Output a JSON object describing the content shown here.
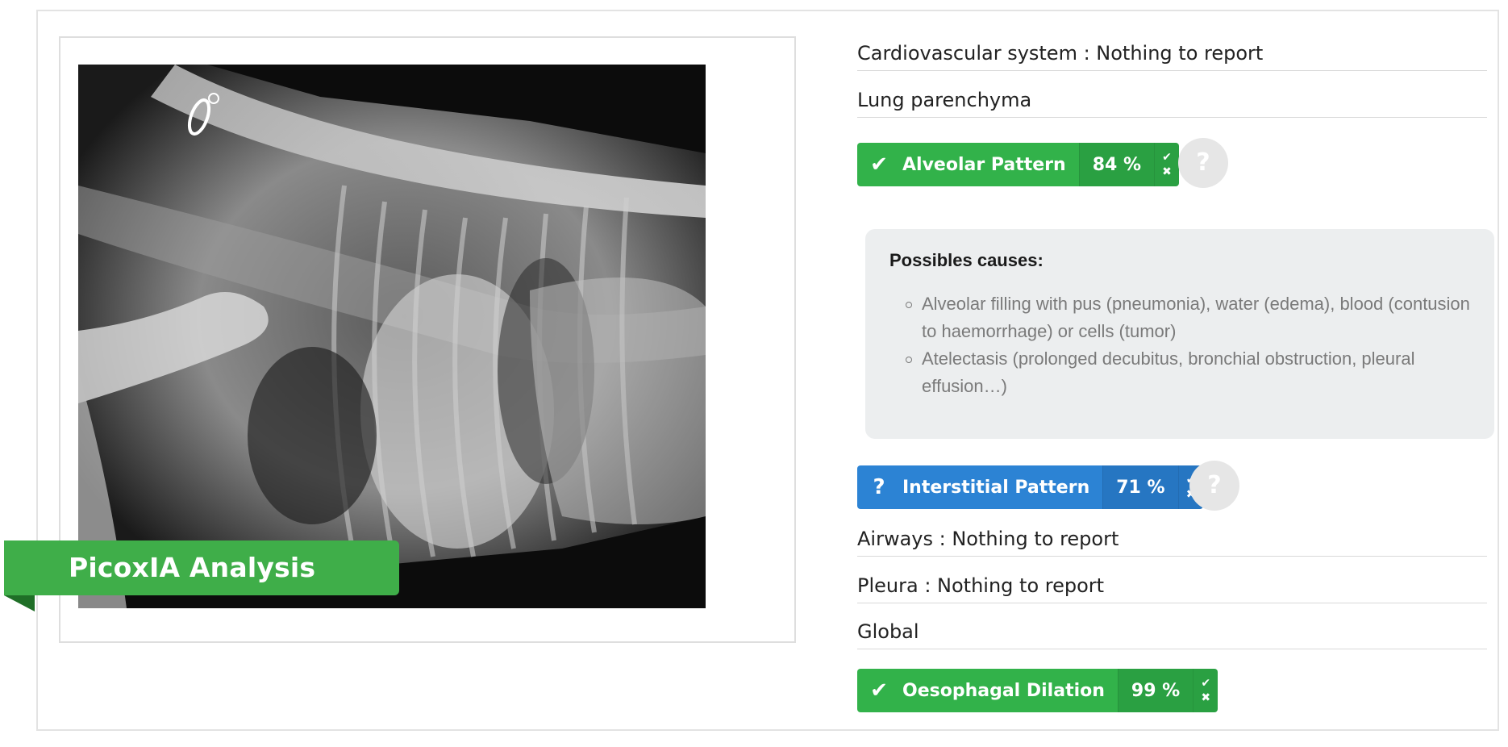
{
  "banner": {
    "title": "PicoxIA Analysis"
  },
  "report": {
    "sections": [
      {
        "label": "Cardiovascular system : Nothing to report"
      },
      {
        "label": "Lung parenchyma"
      },
      {
        "label": "Airways : Nothing to report"
      },
      {
        "label": "Pleura : Nothing to report"
      },
      {
        "label": "Global"
      }
    ],
    "findings": [
      {
        "label": "Alveolar Pattern",
        "percent": "84 %",
        "status_icon": "check-icon",
        "color": "#32b24a"
      },
      {
        "label": "Interstitial Pattern",
        "percent": "71 %",
        "status_icon": "question-icon",
        "color": "#2c83d4"
      },
      {
        "label": "Oesophagal Dilation",
        "percent": "99 %",
        "status_icon": "check-icon",
        "color": "#32b24a"
      }
    ],
    "help_symbol": "?",
    "action_confirm_symbol": "✔",
    "action_reject_symbol": "✖"
  },
  "causes": {
    "title": "Possibles causes:",
    "items": [
      "Alveolar filling with pus (pneumonia), water (edema), blood (contusion to haemorrhage) or cells (tumor)",
      "Atelectasis (prolonged decubitus, bronchial obstruction, pleural effusion…)"
    ]
  }
}
